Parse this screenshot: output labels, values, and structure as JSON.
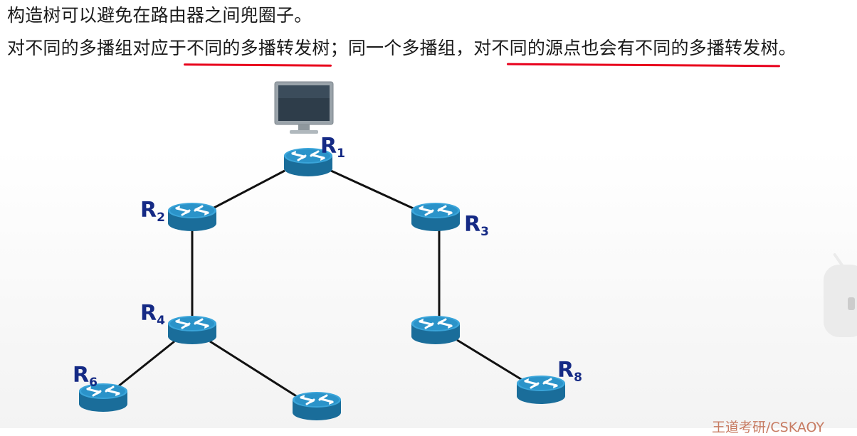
{
  "text": {
    "line1": "构造树可以避免在路由器之间兜圈子。",
    "line2_part1": "对不同的多播组对应于",
    "line2_highlight1": "不同的多播转发树",
    "line2_part2": "；同一个多播组，对不",
    "line2_highlight2": "同的源点也会有不同的多播转发树",
    "line2_part3": "。"
  },
  "routers": {
    "r1": {
      "letter": "R",
      "num": "1"
    },
    "r2": {
      "letter": "R",
      "num": "2"
    },
    "r3": {
      "letter": "R",
      "num": "3"
    },
    "r4": {
      "letter": "R",
      "num": "4"
    },
    "r6": {
      "letter": "R",
      "num": "6"
    },
    "r8": {
      "letter": "R",
      "num": "8"
    }
  },
  "watermark": "王道考研/CSKAOY",
  "colors": {
    "underline": "#e8001c",
    "label": "#152a85",
    "router": "#2a8fc4",
    "watermark": "#c77b62"
  }
}
